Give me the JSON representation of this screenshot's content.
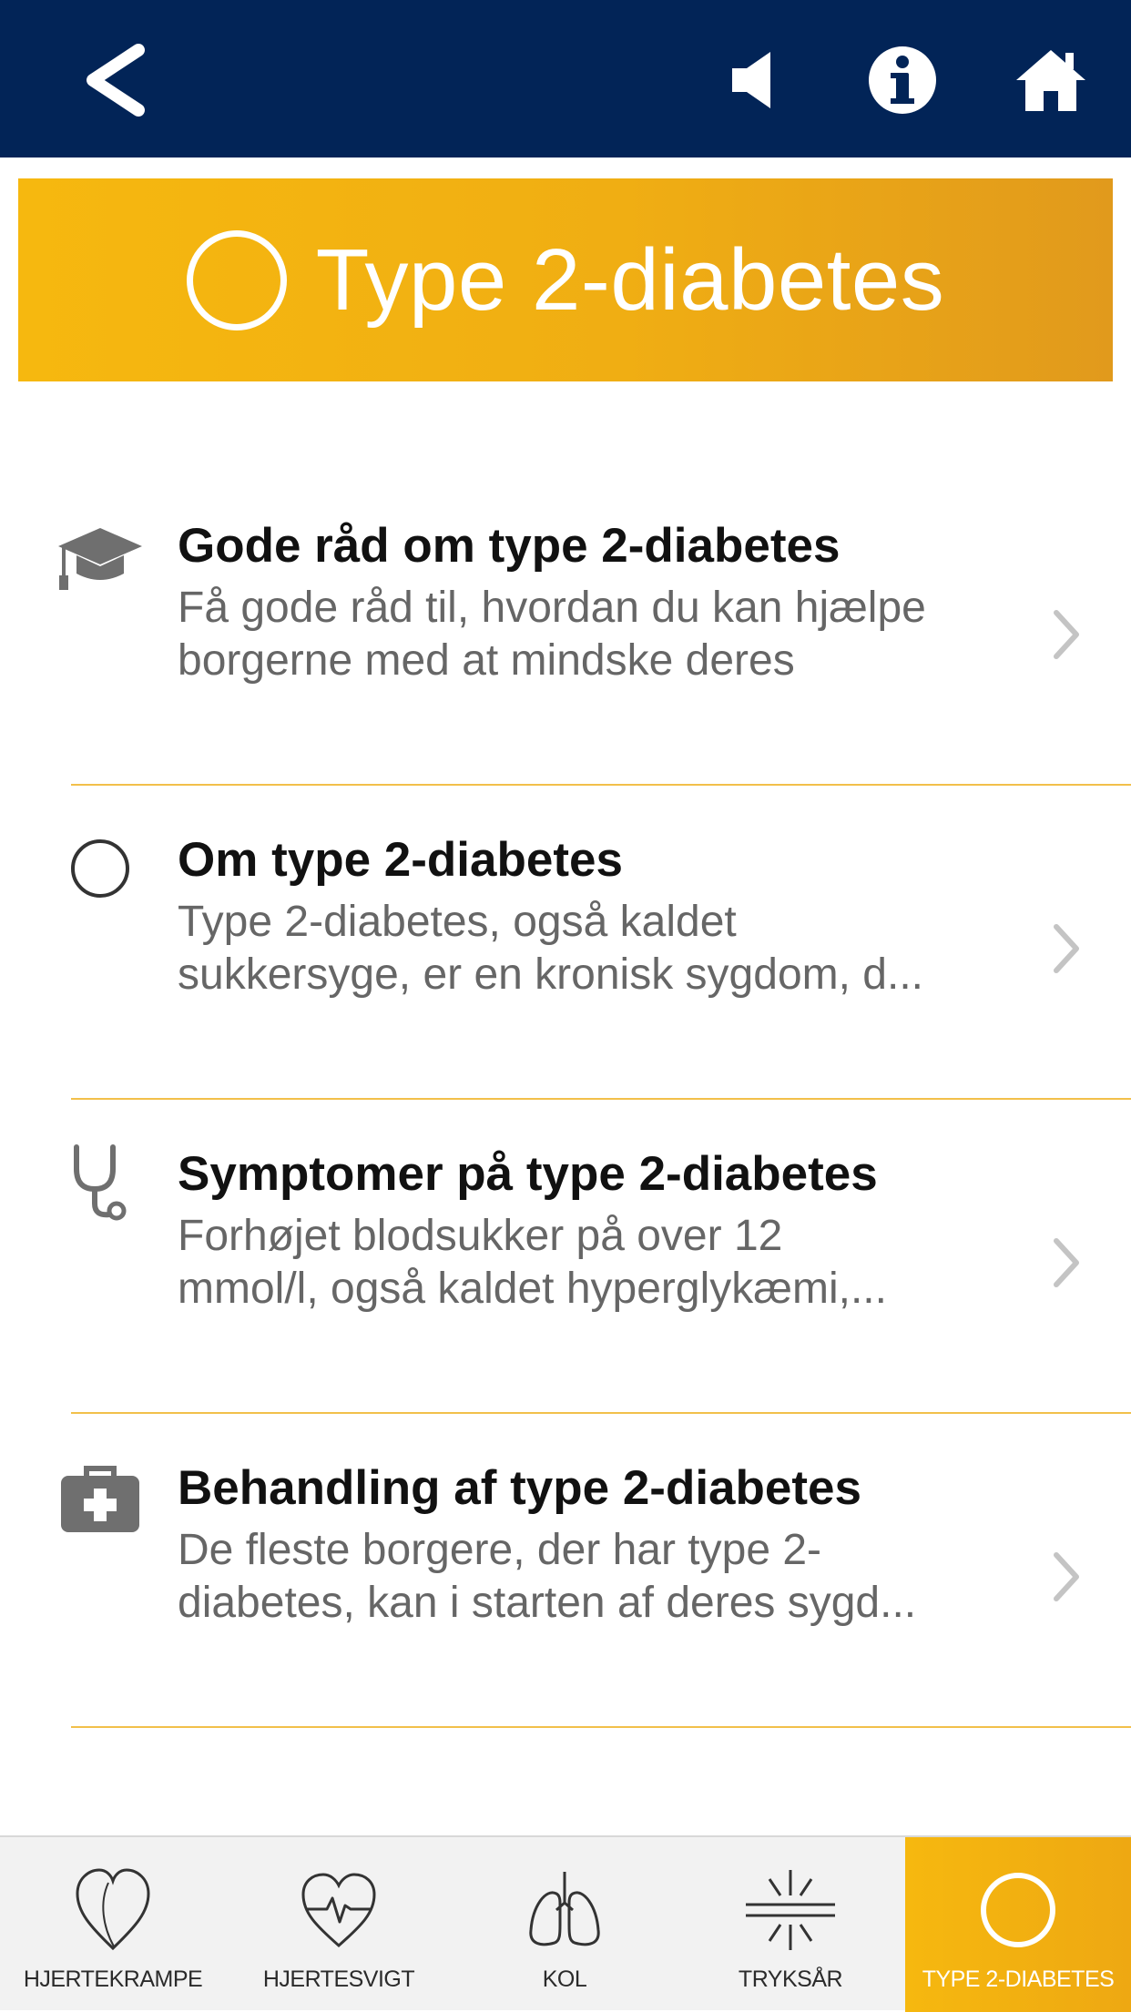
{
  "nav": {
    "back_icon": "chevron-left-icon",
    "sound_icon": "speaker-icon",
    "info_icon": "info-icon",
    "home_icon": "home-icon"
  },
  "header": {
    "title": "Type 2-diabetes",
    "icon": "ring-icon",
    "color": "#f6b80f"
  },
  "items": [
    {
      "icon": "graduation-cap-icon",
      "title": "Gode råd om type 2-diabetes",
      "line1": "Få gode råd til, hvordan du kan hjælpe",
      "line2": "borgerne med at mindske deres"
    },
    {
      "icon": "circle-icon",
      "title": "Om type 2-diabetes",
      "line1": "Type 2-diabetes, også kaldet",
      "line2": "sukkersyge, er en kronisk sygdom, d..."
    },
    {
      "icon": "stethoscope-icon",
      "title": "Symptomer på type 2-diabetes",
      "line1": "Forhøjet blodsukker på over 12",
      "line2": "mmol/l, også kaldet hyperglykæmi,..."
    },
    {
      "icon": "first-aid-kit-icon",
      "title": "Behandling af type 2-diabetes",
      "line1": "De fleste borgere, der har type 2-",
      "line2": "diabetes, kan i starten af deres sygd..."
    }
  ],
  "tabs": [
    {
      "label": "HJERTEKRAMPE",
      "icon": "heart-icon",
      "active": false
    },
    {
      "label": "HJERTESVIGT",
      "icon": "heart-pulse-icon",
      "active": false
    },
    {
      "label": "KOL",
      "icon": "lungs-icon",
      "active": false
    },
    {
      "label": "TRYKSÅR",
      "icon": "pressure-icon",
      "active": false
    },
    {
      "label": "TYPE 2-DIABETES",
      "icon": "ring-icon",
      "active": true
    }
  ],
  "colors": {
    "nav_bg": "#022457",
    "accent": "#f6b80f",
    "divider": "#f2c04a",
    "icon_gray": "#6f6f6f"
  }
}
